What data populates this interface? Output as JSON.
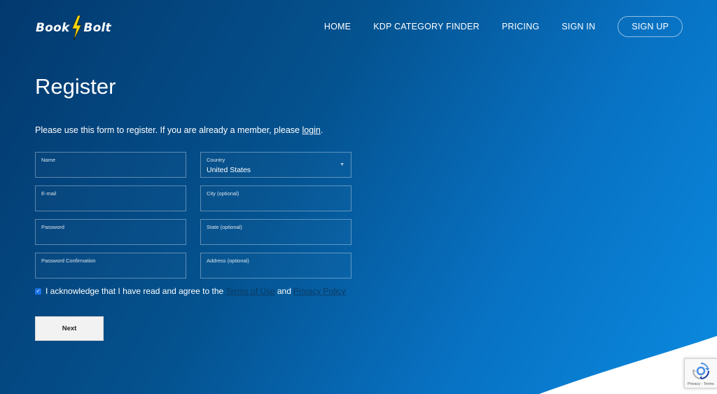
{
  "logo": {
    "part1": "Book",
    "part2": "Bolt"
  },
  "nav": {
    "items": [
      "HOME",
      "KDP CATEGORY FINDER",
      "PRICING",
      "SIGN IN"
    ],
    "signup": "SIGN UP"
  },
  "page": {
    "title": "Register",
    "intro": "Please use this form to register. If you are already a member, please ",
    "intro_link": "login",
    "intro_end": "."
  },
  "form": {
    "name_label": "Name",
    "email_label": "E-mail",
    "password_label": "Password",
    "password_confirm_label": "Password Confirmation",
    "country_label": "Country",
    "country_value": "United States",
    "city_label": "City (optional)",
    "state_label": "State (optional)",
    "address_label": "Address (optional)",
    "ack_text": "I acknowledge that I have read and agree to the",
    "terms_link": "Terms of Use",
    "and_text": "and",
    "privacy_link": "Privacy Policy",
    "next_label": "Next"
  },
  "recaptcha": {
    "text": "Privacy - Terms"
  },
  "colors": {
    "bg_start": "#03396e",
    "bg_end": "#0a8ae0",
    "bolt": "#f5d60a",
    "button_bg": "#f2f2f2",
    "checkbox": "#1a73e8"
  },
  "icons": [
    "lightning-bolt-icon",
    "chevron-down-icon",
    "check-icon",
    "recaptcha-icon"
  ]
}
